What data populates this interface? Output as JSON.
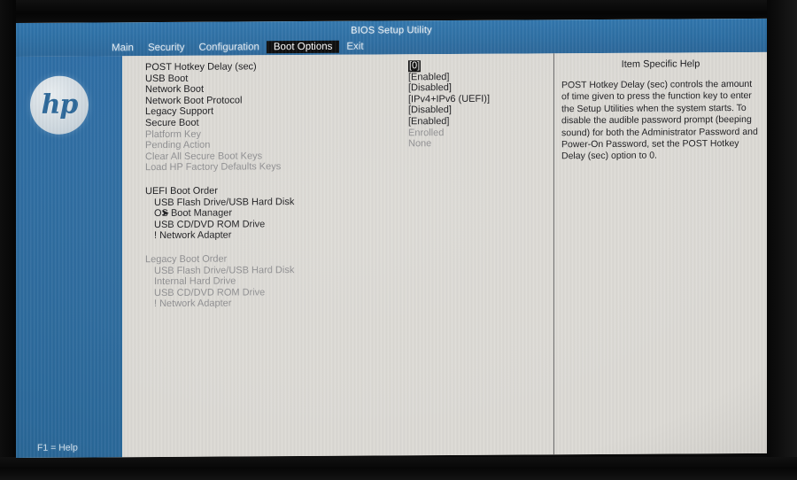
{
  "window": {
    "title": "BIOS Setup Utility",
    "vendor_logo": "hp",
    "logo_text": "hp"
  },
  "menubar": {
    "items": [
      {
        "label": "Main",
        "selected": false
      },
      {
        "label": "Security",
        "selected": false
      },
      {
        "label": "Configuration",
        "selected": false
      },
      {
        "label": "Boot Options",
        "selected": true
      },
      {
        "label": "Exit",
        "selected": false
      }
    ]
  },
  "sidebar": {
    "footer_hint": "F1 = Help"
  },
  "settings": {
    "rows": [
      {
        "label": "POST Hotkey Delay (sec)",
        "value": "[0]",
        "state": "selected",
        "indent": 0
      },
      {
        "label": "USB Boot",
        "value": "[Enabled]",
        "state": "normal",
        "indent": 0
      },
      {
        "label": "Network Boot",
        "value": "[Disabled]",
        "state": "normal",
        "indent": 0
      },
      {
        "label": "Network Boot Protocol",
        "value": "[IPv4+IPv6 (UEFI)]",
        "state": "normal",
        "indent": 0
      },
      {
        "label": "Legacy Support",
        "value": "[Disabled]",
        "state": "normal",
        "indent": 0
      },
      {
        "label": "Secure Boot",
        "value": "[Enabled]",
        "state": "normal",
        "indent": 0
      },
      {
        "label": "Platform Key",
        "value": "Enrolled",
        "state": "disabled",
        "indent": 0
      },
      {
        "label": "Pending Action",
        "value": "None",
        "state": "disabled",
        "indent": 0
      },
      {
        "label": "Clear All Secure Boot Keys",
        "value": "",
        "state": "disabled",
        "indent": 0
      },
      {
        "label": "Load HP Factory Defaults Keys",
        "value": "",
        "state": "disabled",
        "indent": 0
      }
    ]
  },
  "uefi_boot_order": {
    "heading": "UEFI Boot Order",
    "entries": [
      {
        "label": "USB Flash Drive/USB Hard Disk",
        "cursor": false,
        "state": "normal"
      },
      {
        "label": "OS Boot Manager",
        "cursor": true,
        "state": "normal"
      },
      {
        "label": "USB CD/DVD ROM Drive",
        "cursor": false,
        "state": "normal"
      },
      {
        "label": "! Network Adapter",
        "cursor": false,
        "state": "normal"
      }
    ],
    "cursor_glyph": "➤"
  },
  "legacy_boot_order": {
    "heading": "Legacy Boot Order",
    "entries": [
      {
        "label": "USB Flash Drive/USB Hard Disk",
        "state": "disabled"
      },
      {
        "label": "Internal Hard Drive",
        "state": "disabled"
      },
      {
        "label": "USB CD/DVD ROM Drive",
        "state": "disabled"
      },
      {
        "label": "! Network Adapter",
        "state": "disabled"
      }
    ]
  },
  "help": {
    "title": "Item Specific Help",
    "body": "POST Hotkey Delay (sec) controls the amount of time given to press the function key to enter the Setup Utilities when the system starts. To disable the audible password prompt (beeping sound) for both the Administrator Password and Power-On Password, set the POST Hotkey Delay (sec) option to 0."
  },
  "colors": {
    "header_blue": "#2c6da2",
    "rail_blue": "#2b6a9e",
    "panel_bg": "#dcdad5",
    "text": "#17171a",
    "text_disabled": "#8d8d8f",
    "selection_bg": "#0c0c0c",
    "bezel": "#0a0a0a"
  }
}
